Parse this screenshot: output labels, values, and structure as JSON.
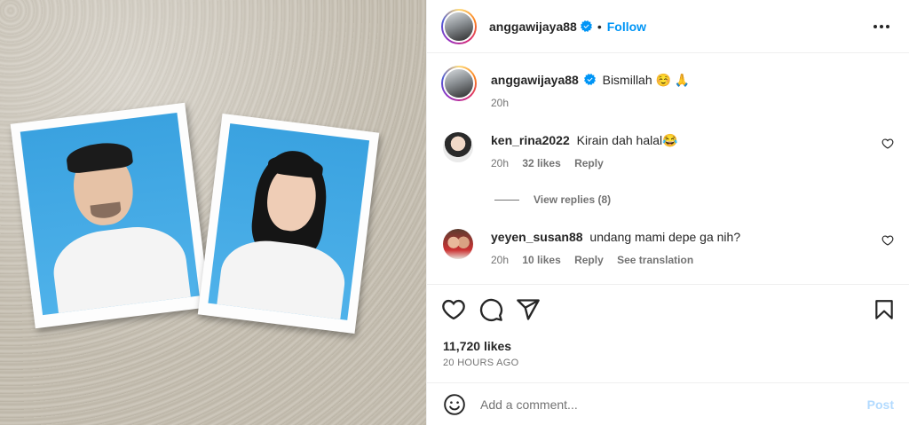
{
  "header": {
    "username": "anggawijaya88",
    "dot": "•",
    "follow_label": "Follow",
    "more_icon": "more-horizontal-icon"
  },
  "caption": {
    "username": "anggawijaya88",
    "text": "Bismillah ☺️ 🙏",
    "age": "20h"
  },
  "comments": [
    {
      "username": "ken_rina2022",
      "text": "Kirain dah halal😂",
      "age": "20h",
      "likes": "32 likes",
      "reply_label": "Reply"
    },
    {
      "username": "yeyen_susan88",
      "text": "undang mami depe ga nih?",
      "age": "20h",
      "likes": "10 likes",
      "reply_label": "Reply",
      "translation_label": "See translation"
    }
  ],
  "view_replies_label": "View replies (8)",
  "post": {
    "likes": "11,720 likes",
    "time": "20 HOURS AGO"
  },
  "add_comment": {
    "placeholder": "Add a comment...",
    "post_label": "Post"
  },
  "colors": {
    "accent": "#0095f6",
    "post_disabled": "#b3dbff",
    "muted": "#737373",
    "photo_background": "#3aa2e0"
  }
}
